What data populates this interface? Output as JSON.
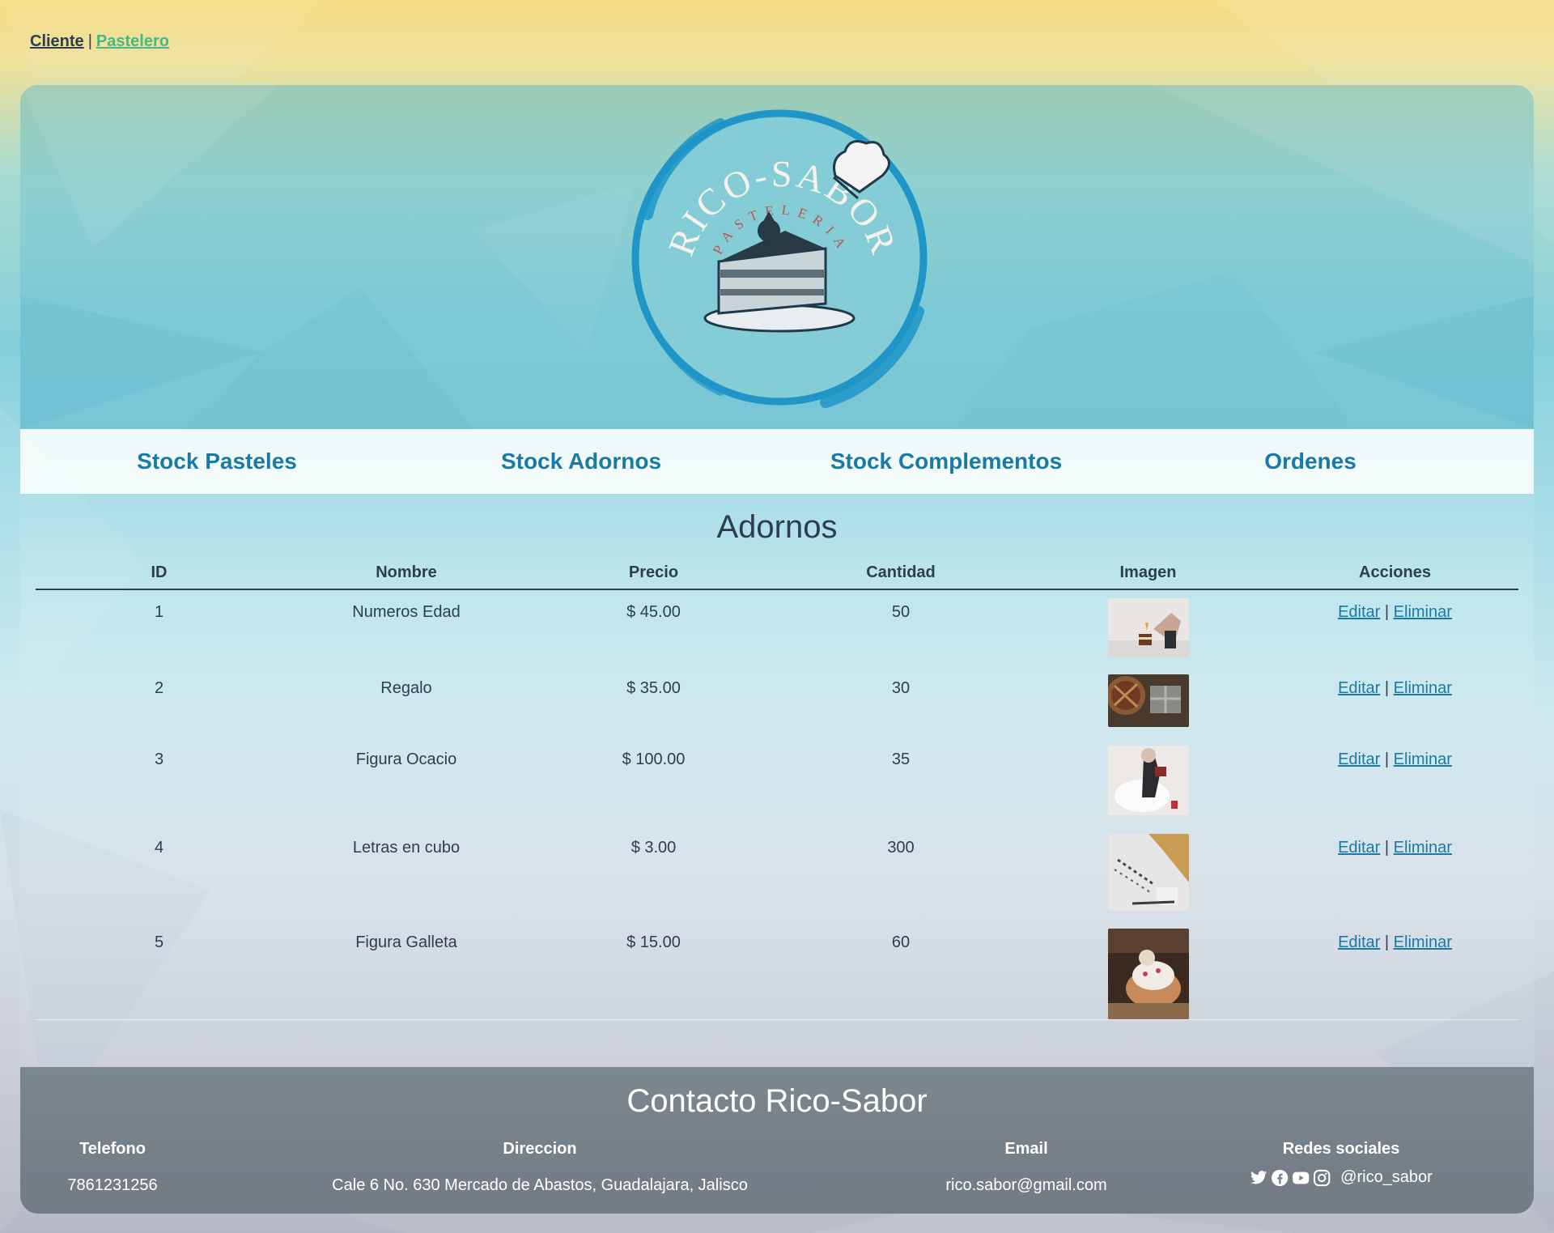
{
  "topnav": {
    "cliente": "Cliente",
    "separator": "|",
    "pastelero": "Pastelero"
  },
  "brand": {
    "logo_text": "RICO-SABOR",
    "logo_subtext": "PASTELERIA"
  },
  "menu": {
    "items": [
      {
        "label": "Stock Pasteles"
      },
      {
        "label": "Stock Adornos"
      },
      {
        "label": "Stock Complementos"
      },
      {
        "label": "Ordenes"
      }
    ]
  },
  "section_title": "Adornos",
  "table": {
    "headers": [
      "ID",
      "Nombre",
      "Precio",
      "Cantidad",
      "Imagen",
      "Acciones"
    ],
    "rows": [
      {
        "id": "1",
        "nombre": "Numeros Edad",
        "precio": "$ 45.00",
        "cantidad": "50",
        "image": "cake-candle-photo"
      },
      {
        "id": "2",
        "nombre": "Regalo",
        "precio": "$ 35.00",
        "cantidad": "30",
        "image": "pie-gift-photo"
      },
      {
        "id": "3",
        "nombre": "Figura Ocacio",
        "precio": "$ 100.00",
        "cantidad": "35",
        "image": "figure-cake-photo"
      },
      {
        "id": "4",
        "nombre": "Letras en cubo",
        "precio": "$ 3.00",
        "cantidad": "300",
        "image": "letters-cube-photo"
      },
      {
        "id": "5",
        "nombre": "Figura Galleta",
        "precio": "$ 15.00",
        "cantidad": "60",
        "image": "cookie-figure-photo"
      }
    ],
    "edit_label": "Editar",
    "action_separator": "|",
    "delete_label": "Eliminar"
  },
  "footer": {
    "title": "Contacto Rico-Sabor",
    "telefono_label": "Telefono",
    "telefono": "7861231256",
    "direccion_label": "Direccion",
    "direccion": "Cale 6 No. 630 Mercado de Abastos, Guadalajara, Jalisco",
    "email_label": "Email",
    "email": "rico.sabor@gmail.com",
    "redes_label": "Redes sociales",
    "social_handle": "@rico_sabor",
    "social_icons": [
      "twitter-icon",
      "facebook-icon",
      "youtube-icon",
      "instagram-icon"
    ]
  },
  "colors": {
    "accent": "#1b7aa5",
    "link_green": "#42b983",
    "text": "#2c3e50",
    "footer_bg": "#77818a",
    "logo_blue": "#1f95c8"
  }
}
